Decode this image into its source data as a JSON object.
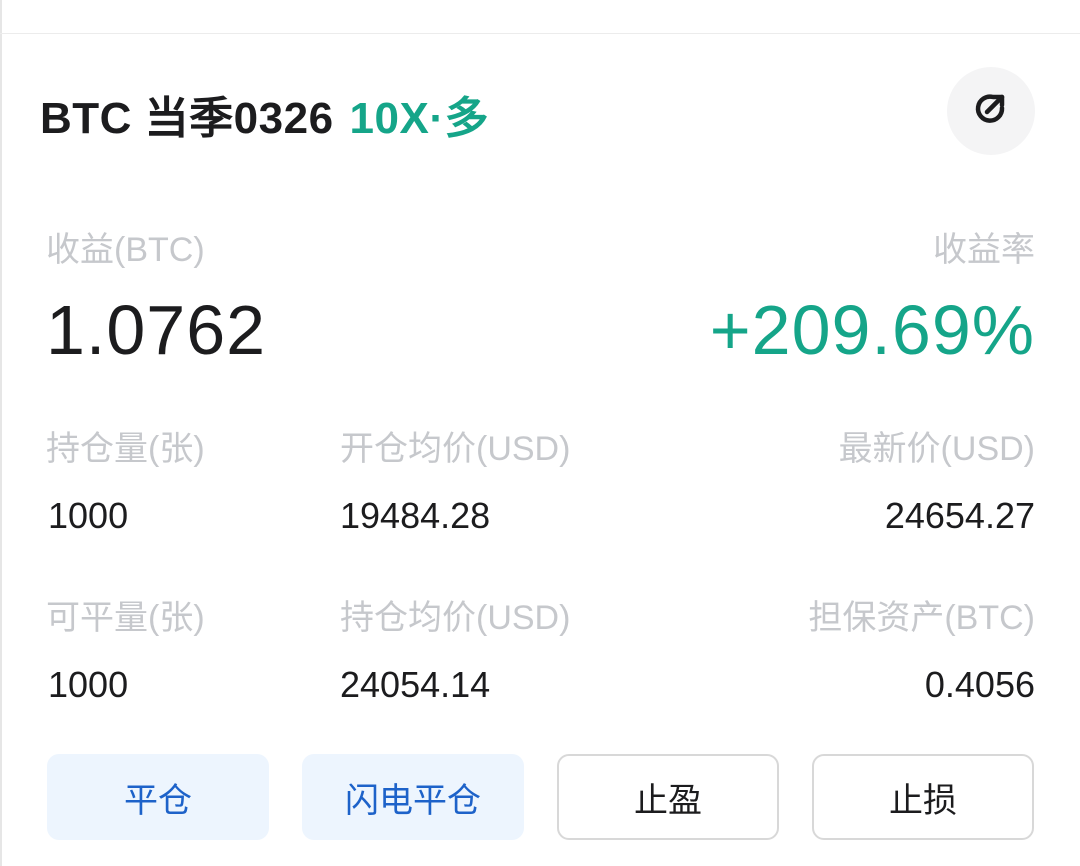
{
  "position": {
    "symbol": "BTC 当季0326",
    "leverage_side": "10X·多"
  },
  "share_icon": "share-arrow-icon",
  "pnl": {
    "label": "收益(BTC)",
    "value": "1.0762",
    "rate_label": "收益率",
    "rate_value": "+209.69%"
  },
  "row1": {
    "qty_label": "持仓量(张)",
    "qty_value": "1000",
    "open_price_label": "开仓均价(USD)",
    "open_price_value": "19484.28",
    "last_price_label": "最新价(USD)",
    "last_price_value": "24654.27"
  },
  "row2": {
    "closeable_label": "可平量(张)",
    "closeable_value": "1000",
    "hold_price_label": "持仓均价(USD)",
    "hold_price_value": "24054.14",
    "margin_label": "担保资产(BTC)",
    "margin_value": "0.4056"
  },
  "actions": {
    "close": "平仓",
    "flash_close": "闪电平仓",
    "take_profit": "止盈",
    "stop_loss": "止损"
  },
  "colors": {
    "accent_green": "#15a589",
    "action_blue": "#1d62c9",
    "action_blue_bg": "#edf5fe",
    "label_gray": "#c6c8cc",
    "text_dark": "#1c1c1e"
  }
}
